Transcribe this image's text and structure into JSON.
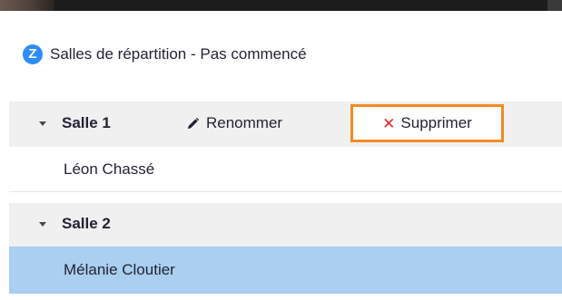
{
  "window": {
    "title": "Salles de répartition - Pas commencé",
    "logo_letter": "Z",
    "logo_color": "#2d8cff"
  },
  "rooms": [
    {
      "name": "Salle 1",
      "expanded": true,
      "actions": {
        "rename_label": "Renommer",
        "rename_icon": "pencil-icon",
        "delete_label": "Supprimer",
        "delete_icon": "close-icon",
        "delete_highlight_color": "#f28b21"
      },
      "participants": [
        "Léon Chassé"
      ]
    },
    {
      "name": "Salle 2",
      "expanded": true,
      "participants": [
        "Mélanie Cloutier"
      ],
      "selected_participant": "Mélanie Cloutier",
      "selection_color": "#aacff0"
    }
  ]
}
